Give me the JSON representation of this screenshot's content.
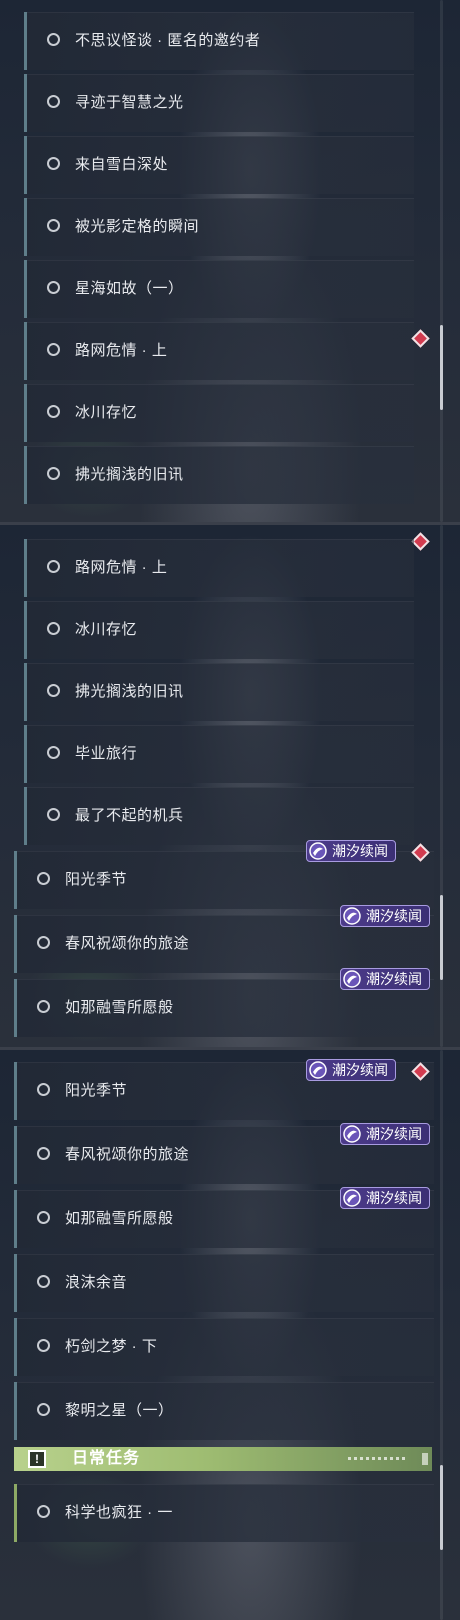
{
  "panel1": {
    "quests": [
      {
        "name": "不思议怪谈 · 匿名的邀约者"
      },
      {
        "name": "寻迹于智慧之光"
      },
      {
        "name": "来自雪白深处"
      },
      {
        "name": "被光影定格的瞬间"
      },
      {
        "name": "星海如故（一）"
      },
      {
        "name": "路网危情 · 上"
      },
      {
        "name": "冰川存忆"
      },
      {
        "name": "拂光搁浅的旧讯"
      }
    ]
  },
  "panel2": {
    "quests": [
      {
        "name": "路网危情 · 上"
      },
      {
        "name": "冰川存忆"
      },
      {
        "name": "拂光搁浅的旧讯"
      },
      {
        "name": "毕业旅行"
      },
      {
        "name": "最了不起的机兵"
      },
      {
        "name": "阳光季节",
        "badge": "潮汐续闻"
      },
      {
        "name": "春风祝颂你的旅途",
        "badge": "潮汐续闻"
      },
      {
        "name": "如那融雪所愿般",
        "badge": "潮汐续闻"
      }
    ]
  },
  "panel3": {
    "quests": [
      {
        "name": "阳光季节",
        "badge": "潮汐续闻"
      },
      {
        "name": "春风祝颂你的旅途",
        "badge": "潮汐续闻"
      },
      {
        "name": "如那融雪所愿般",
        "badge": "潮汐续闻"
      },
      {
        "name": "浪沫余音"
      },
      {
        "name": "朽剑之梦 · 下"
      },
      {
        "name": "黎明之星（一）"
      }
    ],
    "daily_section": {
      "icon": "exclamation-icon",
      "label": "日常任务",
      "quests": [
        {
          "name": "科学也疯狂 · 一"
        }
      ]
    }
  },
  "colors": {
    "tracked_diamond": "#d23b4f",
    "badge_bg": "#4c3b8a",
    "daily_header": "#b8d18c",
    "row_accent": "#5f7e8a"
  },
  "icons": {
    "quest_status": "circle-outline-icon",
    "tracked": "red-diamond-icon",
    "badge": "tide-swirl-icon",
    "daily": "exclamation-icon"
  }
}
